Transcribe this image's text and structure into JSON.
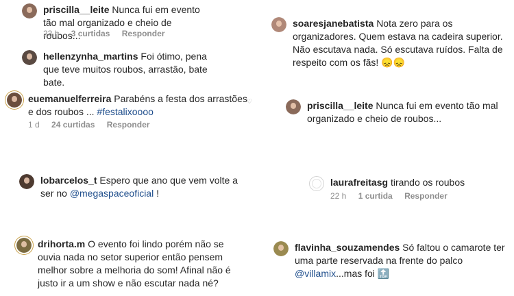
{
  "left_column": [
    {
      "username": "priscilla__leite",
      "text": "Nunca fui em evento tão mal organizado e cheio de roubos...",
      "time": "23 h",
      "likes": "3 curtidas",
      "reply": "Responder",
      "avatar_color": "#8a6a5a"
    },
    {
      "username": "hellenzynha_martins",
      "text": "Foi ótimo, pena que teve muitos roubos, arrastão, bate bate.",
      "avatar_color": "#5a4a42"
    },
    {
      "username": "euemanuelferreira",
      "text": "Parabéns a festa dos arrastões e dos roubos ...",
      "hashtag": "#festalixoooo",
      "time": "1 d",
      "likes": "24 curtidas",
      "reply": "Responder",
      "heart_icon": "♡",
      "avatar_color": "#6b4e3d"
    },
    {
      "username": "lobarcelos_t",
      "text": "Espero que ano que vem volte a ser no",
      "mention": "@megaspaceoficial",
      "suffix": "!",
      "avatar_color": "#4d3a30"
    },
    {
      "username": "drihorta.m",
      "text": "O evento foi lindo porém não se ouvia nada  no setor superior então pensem melhor sobre a melhoria do som! Afinal não é justo ir a um show e não escutar nada né?",
      "avatar_color": "#7a6a40"
    }
  ],
  "right_column": [
    {
      "username": "soaresjanebatista",
      "text": "Nota zero para os organizadores. Quem estava na cadeira superior. Não escutava nada. Só escutava ruídos. Falta de respeito com os fãs! 😞😞",
      "avatar_color": "#b08878"
    },
    {
      "username": "priscilla__leite",
      "text": "Nunca fui em evento tão mal organizado e cheio de roubos...",
      "avatar_color": "#8a6a5a"
    },
    {
      "username": "laurafreitasg",
      "text": "tirando os roubos",
      "time": "22 h",
      "likes": "1 curtida",
      "reply": "Responder"
    },
    {
      "username": "flavinha_souzamendes",
      "text": "Só faltou o camarote ter uma parte reservada na frente do palco",
      "mention": "@villamix",
      "suffix": "...mas foi 🔝",
      "avatar_color": "#9a8a50"
    }
  ]
}
